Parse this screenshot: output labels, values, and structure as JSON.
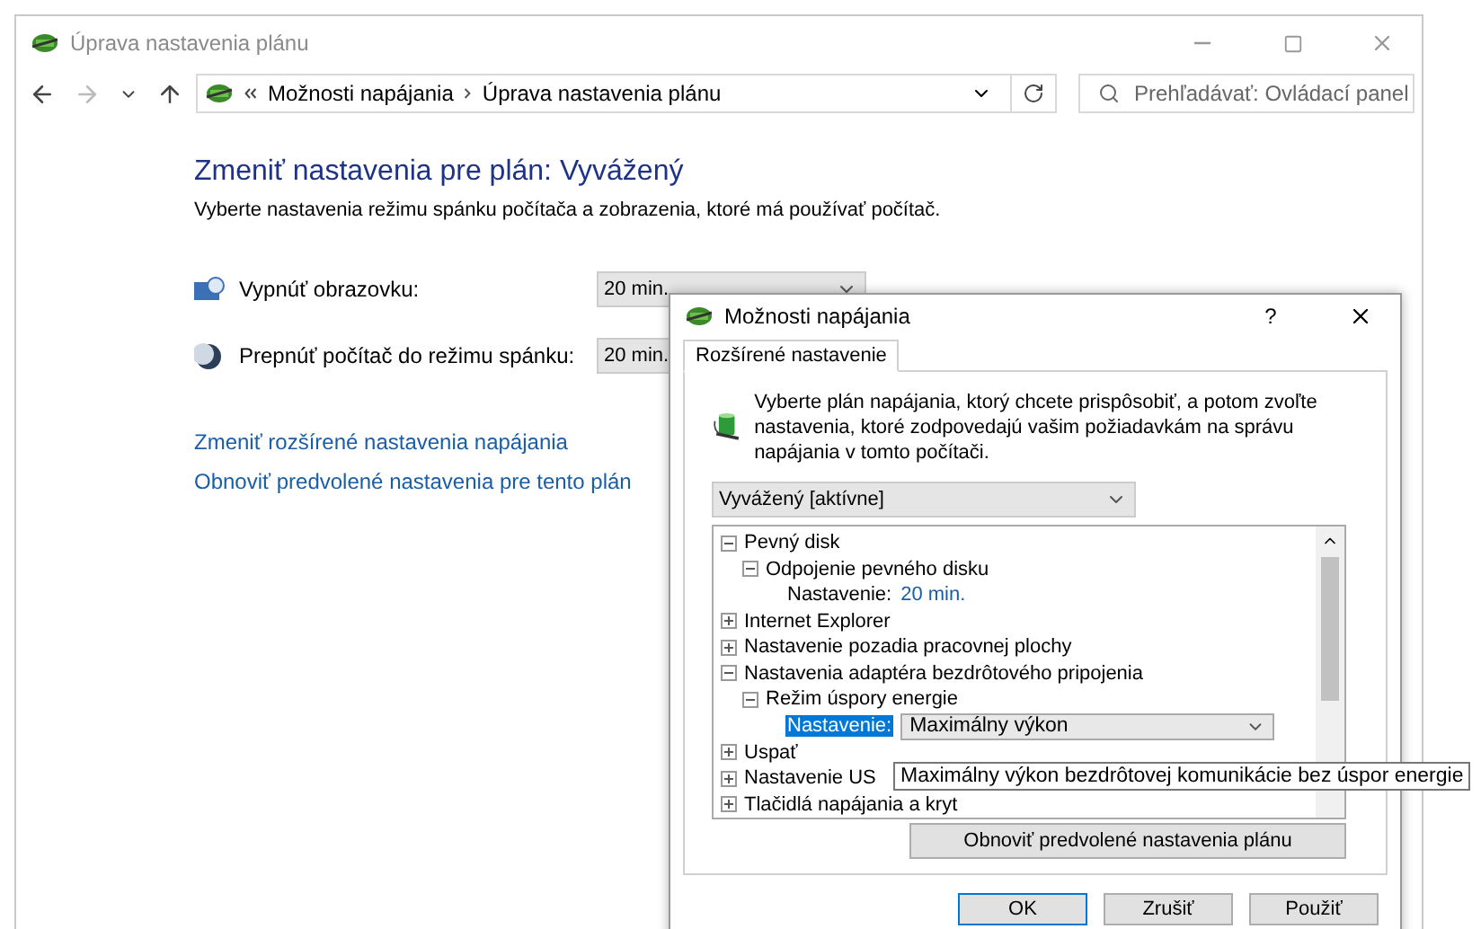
{
  "window": {
    "title": "Úprava nastavenia plánu"
  },
  "address": {
    "breadcrumbs": [
      "Možnosti napájania",
      "Úprava nastavenia plánu"
    ]
  },
  "search": {
    "placeholder": "Prehľadávať: Ovládací panel"
  },
  "heading": "Zmeniť nastavenia pre plán: Vyvážený",
  "subtitle": "Vyberte nastavenia režimu spánku počítača a zobrazenia, ktoré má používať počítač.",
  "settings": [
    {
      "kind": "display",
      "label": "Vypnúť obrazovku:",
      "value": "20 min."
    },
    {
      "kind": "sleep",
      "label": "Prepnúť počítač do režimu spánku:",
      "value": "20 min."
    }
  ],
  "links": [
    "Zmeniť rozšírené nastavenia napájania",
    "Obnoviť predvolené nastavenia pre tento plán"
  ],
  "dialog": {
    "title": "Možnosti napájania",
    "help": "?",
    "tabs": [
      {
        "label": "Rozšírené nastavenie",
        "selected": true
      }
    ],
    "intro": "Vyberte plán napájania, ktorý chcete prispôsobiť, a potom zvoľte nastavenia, ktoré zodpovedajú vašim požiadavkám na správu napájania v tomto počítači.",
    "plan": "Vyvážený [aktívne]",
    "tree": [
      {
        "kind": "group",
        "label": "Pevný disk",
        "expanded": true,
        "children": [
          {
            "kind": "group",
            "label": "Odpojenie pevného disku",
            "expanded": true,
            "children": [
              {
                "kind": "value",
                "label": "Nastavenie:",
                "value": "20 min.",
                "selected": false
              }
            ]
          }
        ]
      },
      {
        "kind": "group",
        "label": "Internet Explorer",
        "expanded": false
      },
      {
        "kind": "group",
        "label": "Nastavenie pozadia pracovnej plochy",
        "expanded": false
      },
      {
        "kind": "group",
        "label": "Nastavenia adaptéra bezdrôtového pripojenia",
        "expanded": true,
        "children": [
          {
            "kind": "group",
            "label": "Režim úspory energie",
            "expanded": true,
            "children": [
              {
                "kind": "select",
                "label": "Nastavenie:",
                "value": "Maximálny výkon",
                "selected": true
              }
            ]
          }
        ]
      },
      {
        "kind": "group",
        "label": "Uspať",
        "expanded": false
      },
      {
        "kind": "group",
        "label": "Nastavenie US",
        "expanded": false
      },
      {
        "kind": "group",
        "label": "Tlačidlá napájania a kryt",
        "expanded": false
      }
    ],
    "tooltip": "Maximálny výkon bezdrôtovej komunikácie bez úspor energie",
    "restore": "Obnoviť predvolené nastavenia plánu",
    "buttons": [
      {
        "label": "OK",
        "default": true
      },
      {
        "label": "Zrušiť",
        "default": false
      },
      {
        "label": "Použiť",
        "default": false
      }
    ]
  }
}
